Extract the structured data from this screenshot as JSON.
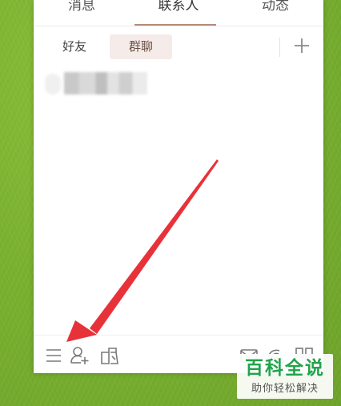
{
  "top_tabs": [
    {
      "label": "消息"
    },
    {
      "label": "联系人",
      "active": true
    },
    {
      "label": "动态"
    }
  ],
  "sub_tabs": [
    {
      "label": "好友"
    },
    {
      "label": "群聊",
      "active": true
    }
  ],
  "toolbar_icons": {
    "add": "plus-icon",
    "bottom": [
      "menu-icon",
      "add-user-icon",
      "app-manager-icon",
      "mail-icon",
      "feeds-icon",
      "grid-icon"
    ]
  },
  "watermark": {
    "title": "百科全说",
    "subtitle": "助你轻松解决"
  },
  "colors": {
    "background_green": "#7ab22f",
    "active_tab_underline": "#b88a7a",
    "active_subtab_bg": "#f5ecea",
    "arrow_red": "#e8323a",
    "watermark_green": "#21a44a"
  }
}
